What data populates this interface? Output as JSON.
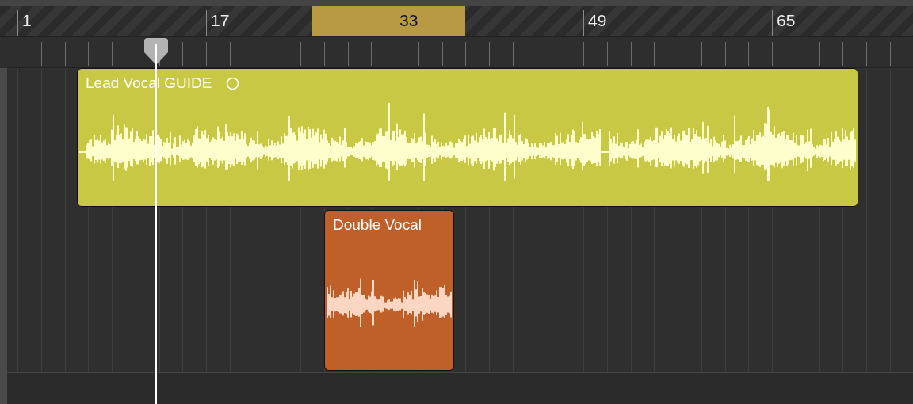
{
  "ruler": {
    "bars": [
      "1",
      "17",
      "33",
      "49",
      "65"
    ],
    "cycle": true
  },
  "regions": [
    {
      "name": "Lead Vocal GUIDE",
      "color": "#c9c845",
      "marker": true
    },
    {
      "name": "Double Vocal",
      "color": "#bf5f2a",
      "marker": false
    }
  ]
}
